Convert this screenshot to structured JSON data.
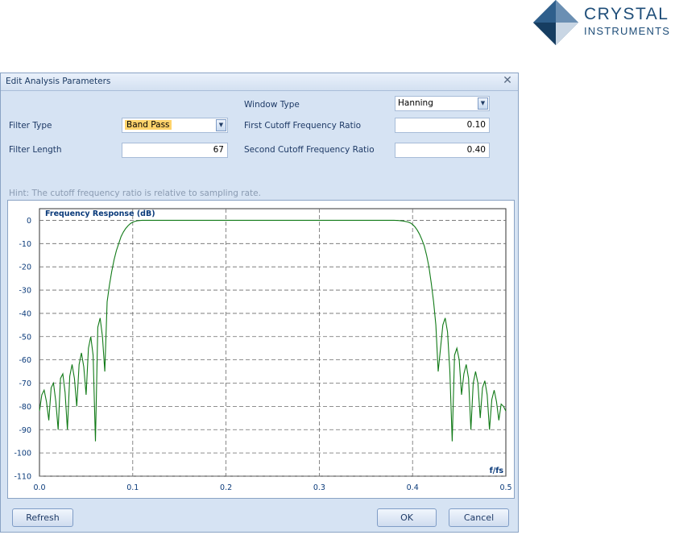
{
  "logo": {
    "line1": "CRYSTAL",
    "line2": "INSTRUMENTS"
  },
  "dialog": {
    "title": "Edit Analysis Parameters",
    "close_glyph": "✕"
  },
  "form": {
    "window_type_label": "Window Type",
    "window_type_value": "Hanning",
    "filter_type_label": "Filter Type",
    "filter_type_value": "Band Pass",
    "first_cutoff_label": "First Cutoff Frequency Ratio",
    "first_cutoff_value": "0.10",
    "filter_length_label": "Filter Length",
    "filter_length_value": "67",
    "second_cutoff_label": "Second Cutoff Frequency Ratio",
    "second_cutoff_value": "0.40",
    "hint": "Hint: The cutoff frequency ratio is relative to sampling rate."
  },
  "buttons": {
    "refresh": "Refresh",
    "ok": "OK",
    "cancel": "Cancel"
  },
  "colors": {
    "curve": "#117a17",
    "grid": "#6a6a6a",
    "axis_text": "#0a3a7a"
  },
  "icons": {
    "dropdown": "chevron-down-icon",
    "close": "close-icon",
    "logo": "diamond-logo-icon"
  },
  "chart_data": {
    "type": "line",
    "title": "Frequency Response (dB)",
    "xlabel": "f/fs",
    "ylabel": "",
    "xlim": [
      0,
      0.5
    ],
    "ylim": [
      -110,
      5
    ],
    "x_ticks": [
      "0.0",
      "0.1",
      "0.2",
      "0.3",
      "0.4",
      "0.5"
    ],
    "y_ticks": [
      "0",
      "-10",
      "-20",
      "-30",
      "-40",
      "-50",
      "-60",
      "-70",
      "-80",
      "-90",
      "-100",
      "-110"
    ],
    "grid": true,
    "series": [
      {
        "x": [
          0.0,
          0.0025,
          0.005,
          0.0075,
          0.01,
          0.0125,
          0.015,
          0.0175,
          0.02,
          0.0225,
          0.025,
          0.0275,
          0.03,
          0.0325,
          0.035,
          0.0375,
          0.04,
          0.0425,
          0.045,
          0.0475,
          0.05,
          0.0525,
          0.055,
          0.0575,
          0.06,
          0.0625,
          0.065,
          0.0675,
          0.07,
          0.0725,
          0.075,
          0.0775,
          0.08,
          0.0825,
          0.085,
          0.0875,
          0.09,
          0.0925,
          0.095,
          0.0975,
          0.1,
          0.1025,
          0.105,
          0.11,
          0.115,
          0.12,
          0.125,
          0.13,
          0.2,
          0.3,
          0.37,
          0.375,
          0.38,
          0.385,
          0.39,
          0.395,
          0.3975,
          0.4,
          0.4025,
          0.405,
          0.4075,
          0.41,
          0.4125,
          0.415,
          0.4175,
          0.42,
          0.4225,
          0.425,
          0.4275,
          0.43,
          0.4325,
          0.435,
          0.4375,
          0.44,
          0.4425,
          0.445,
          0.4475,
          0.45,
          0.4525,
          0.455,
          0.4575,
          0.46,
          0.4625,
          0.465,
          0.4675,
          0.47,
          0.4725,
          0.475,
          0.4775,
          0.48,
          0.4825,
          0.485,
          0.4875,
          0.49,
          0.4925,
          0.495,
          0.4975,
          0.5
        ],
        "y": [
          -82,
          -75,
          -73,
          -78,
          -86,
          -72,
          -70,
          -78,
          -90,
          -68,
          -66,
          -74,
          -90,
          -67,
          -62,
          -68,
          -80,
          -62,
          -57,
          -63,
          -75,
          -55,
          -50,
          -58,
          -95,
          -46,
          -42,
          -50,
          -65,
          -35,
          -28,
          -22,
          -17,
          -13,
          -10,
          -7,
          -5,
          -3.5,
          -2.3,
          -1.4,
          -0.8,
          -0.4,
          -0.2,
          0,
          0,
          0,
          0,
          0,
          0,
          0,
          0,
          0,
          0,
          -0.1,
          -0.3,
          -0.7,
          -1.1,
          -1.8,
          -2.8,
          -4.2,
          -6,
          -8.3,
          -11,
          -15,
          -20,
          -27,
          -35,
          -45,
          -65,
          -55,
          -45,
          -42,
          -48,
          -65,
          -95,
          -58,
          -55,
          -60,
          -75,
          -66,
          -62,
          -68,
          -90,
          -70,
          -65,
          -70,
          -85,
          -72,
          -69,
          -75,
          -90,
          -77,
          -73,
          -78,
          -86,
          -79,
          -80,
          -82
        ]
      }
    ]
  }
}
